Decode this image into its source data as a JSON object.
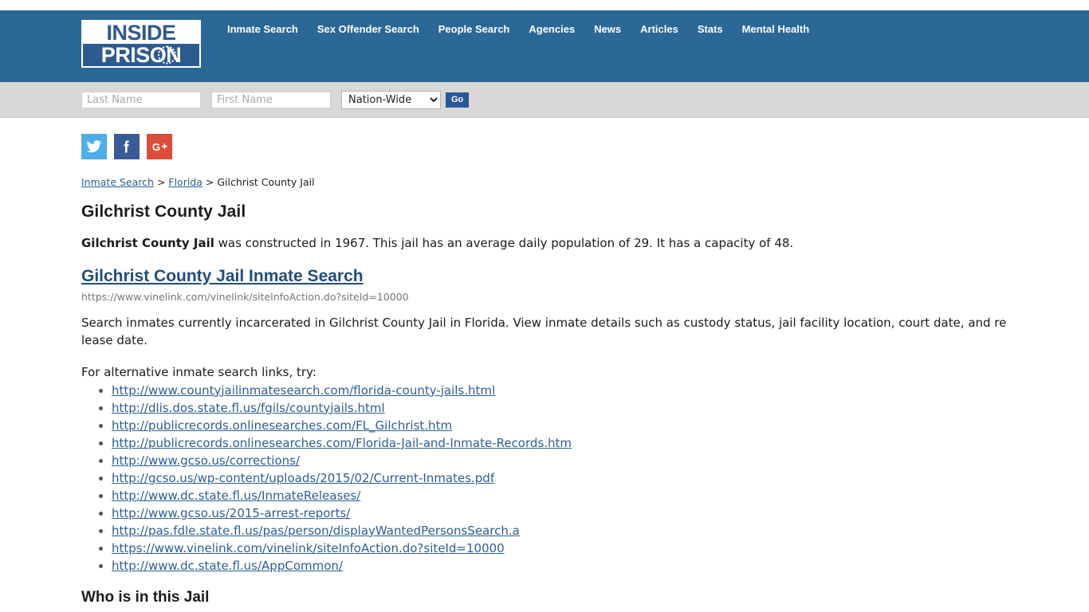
{
  "brand": {
    "logo_top": "INSIDE",
    "logo_bottom": "PRISON"
  },
  "nav": {
    "items": [
      {
        "label": "Inmate Search"
      },
      {
        "label": "Sex Offender Search"
      },
      {
        "label": "People Search"
      },
      {
        "label": "Agencies"
      },
      {
        "label": "News"
      },
      {
        "label": "Articles"
      },
      {
        "label": "Stats"
      },
      {
        "label": "Mental Health"
      }
    ]
  },
  "search": {
    "last_name_placeholder": "Last Name",
    "last_name_value": "",
    "first_name_placeholder": "First Name",
    "first_name_value": "",
    "scope_selected": "Nation-Wide",
    "scope_options": [
      "Nation-Wide"
    ],
    "go_label": "Go"
  },
  "social": {
    "twitter": "twitter-icon",
    "facebook": "facebook-icon",
    "googleplus": "google-plus-icon"
  },
  "breadcrumb": {
    "item1": "Inmate Search",
    "sep1": " > ",
    "item2": "Florida",
    "sep2": " > ",
    "item3": "Gilchrist County Jail"
  },
  "page": {
    "title": "Gilchrist County Jail",
    "lead_bold": "Gilchrist County Jail",
    "lead_rest": " was constructed in 1967. This jail has an average daily population of 29. It has a capacity of 48.",
    "facility_name": "Gilchrist County Jail",
    "year_constructed": "1967",
    "average_daily_population": "29",
    "capacity": "48",
    "inmate_search_heading": "Gilchrist County Jail Inmate Search",
    "inmate_search_url": "https://www.vinelink.com/vinelink/siteInfoAction.do?siteId=10000",
    "description": "Search inmates currently incarcerated in Gilchrist County Jail in Florida. View inmate details such as custody status, jail facility location, court date, and release date.",
    "alternative_intro": "For alternative inmate search links, try:",
    "alternative_links": [
      "http://www.countyjailinmatesearch.com/florida-county-jails.html",
      "http://dlis.dos.state.fl.us/fgils/countyjails.html",
      "http://publicrecords.onlinesearches.com/FL_Gilchrist.htm",
      "http://publicrecords.onlinesearches.com/Florida-Jail-and-Inmate-Records.htm",
      "http://www.gcso.us/corrections/",
      "http://gcso.us/wp-content/uploads/2015/02/Current-Inmates.pdf",
      "http://www.dc.state.fl.us/InmateReleases/",
      "http://www.gcso.us/2015-arrest-reports/",
      "http://pas.fdle.state.fl.us/pas/person/displayWantedPersonsSearch.a",
      "https://www.vinelink.com/vinelink/siteInfoAction.do?siteId=10000",
      "http://www.dc.state.fl.us/AppCommon/"
    ],
    "who_heading": "Who is in this Jail"
  },
  "colors": {
    "header_blue": "#2b6895",
    "logo_blue": "#2e5a8e",
    "search_bar_gray": "#d8d8d8",
    "link_blue": "#2d5e91",
    "heading_link_navy": "#1f4e79",
    "go_button": "#2b5797",
    "twitter": "#4fadea",
    "facebook": "#3a5a98",
    "google_plus": "#dd4b39"
  }
}
